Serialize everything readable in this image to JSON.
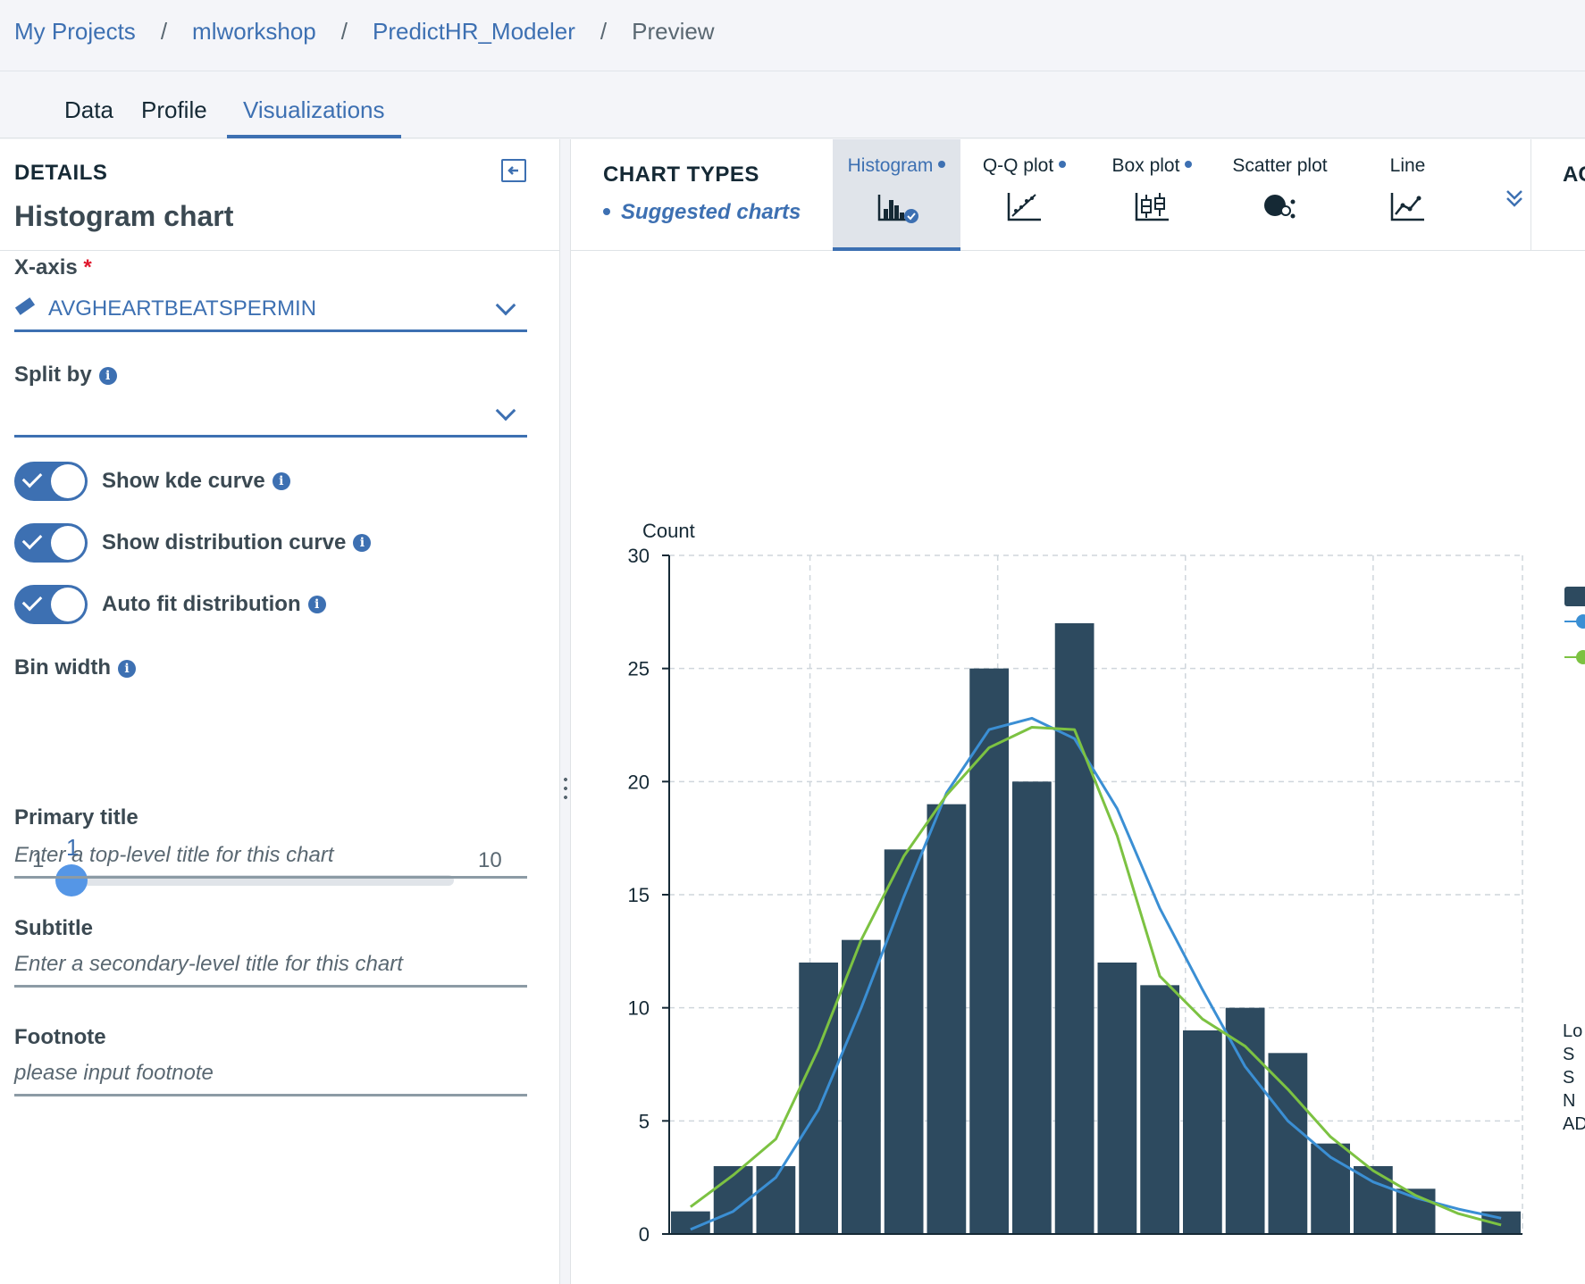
{
  "breadcrumb": [
    "My Projects",
    "mlworkshop",
    "PredictHR_Modeler",
    "Preview"
  ],
  "tabs": [
    {
      "label": "Data",
      "active": false
    },
    {
      "label": "Profile",
      "active": false
    },
    {
      "label": "Visualizations",
      "active": true
    }
  ],
  "details": {
    "section_label": "DETAILS",
    "title": "Histogram chart",
    "x_axis": {
      "label": "X-axis",
      "required_mark": "*",
      "value": "AVGHEARTBEATSPERMIN"
    },
    "split_by": {
      "label": "Split by",
      "value": ""
    },
    "toggles": [
      {
        "label": "Show kde curve",
        "on": true
      },
      {
        "label": "Show distribution curve",
        "on": true
      },
      {
        "label": "Auto fit distribution",
        "on": true
      }
    ],
    "bin_width": {
      "label": "Bin width",
      "min": "1",
      "max": "10",
      "value": "1"
    },
    "primary_title": {
      "label": "Primary title",
      "placeholder": "Enter a top-level title for this chart"
    },
    "subtitle": {
      "label": "Subtitle",
      "placeholder": "Enter a secondary-level title for this chart"
    },
    "footnote": {
      "label": "Footnote",
      "placeholder": "please input footnote"
    }
  },
  "chart_types": {
    "label": "CHART TYPES",
    "suggested": "Suggested charts",
    "items": [
      {
        "label": "Histogram",
        "icon": "histogram-icon",
        "suggested": true,
        "active": true
      },
      {
        "label": "Q-Q plot",
        "icon": "qq-plot-icon",
        "suggested": true,
        "active": false
      },
      {
        "label": "Box plot",
        "icon": "box-plot-icon",
        "suggested": true,
        "active": false
      },
      {
        "label": "Scatter plot",
        "icon": "scatter-plot-icon",
        "suggested": false,
        "active": false
      },
      {
        "label": "Line",
        "icon": "line-chart-icon",
        "suggested": false,
        "active": false
      }
    ],
    "more_icon": "double-chevron-down-icon",
    "truncated_section": "AC"
  },
  "colors": {
    "accent": "#3d70b2",
    "bar": "#2d4a5f",
    "kde": "#3b8fd4",
    "distribution": "#7cc242"
  },
  "side_text": [
    "Lo",
    "S",
    "S",
    "N",
    "AD"
  ],
  "chart_data": {
    "type": "bar",
    "ylabel": "Count",
    "ylim": [
      0,
      30
    ],
    "yticks": [
      0,
      5,
      10,
      15,
      20,
      25,
      30
    ],
    "grid": true,
    "values": [
      1,
      3,
      3,
      12,
      13,
      17,
      19,
      25,
      20,
      27,
      12,
      11,
      9,
      10,
      8,
      4,
      3,
      2,
      0,
      1
    ],
    "series": [
      {
        "type": "line",
        "values": [
          0.2,
          1.0,
          2.5,
          5.5,
          10.0,
          14.9,
          19.5,
          22.3,
          22.8,
          21.9,
          18.8,
          14.4,
          10.8,
          7.4,
          5.0,
          3.4,
          2.3,
          1.6,
          1.1,
          0.7
        ]
      },
      {
        "type": "line",
        "values": [
          1.2,
          2.6,
          4.2,
          8.2,
          13.0,
          16.7,
          19.4,
          21.5,
          22.4,
          22.3,
          17.6,
          11.4,
          9.5,
          8.3,
          6.4,
          4.3,
          2.8,
          1.7,
          0.9,
          0.4
        ]
      }
    ]
  }
}
